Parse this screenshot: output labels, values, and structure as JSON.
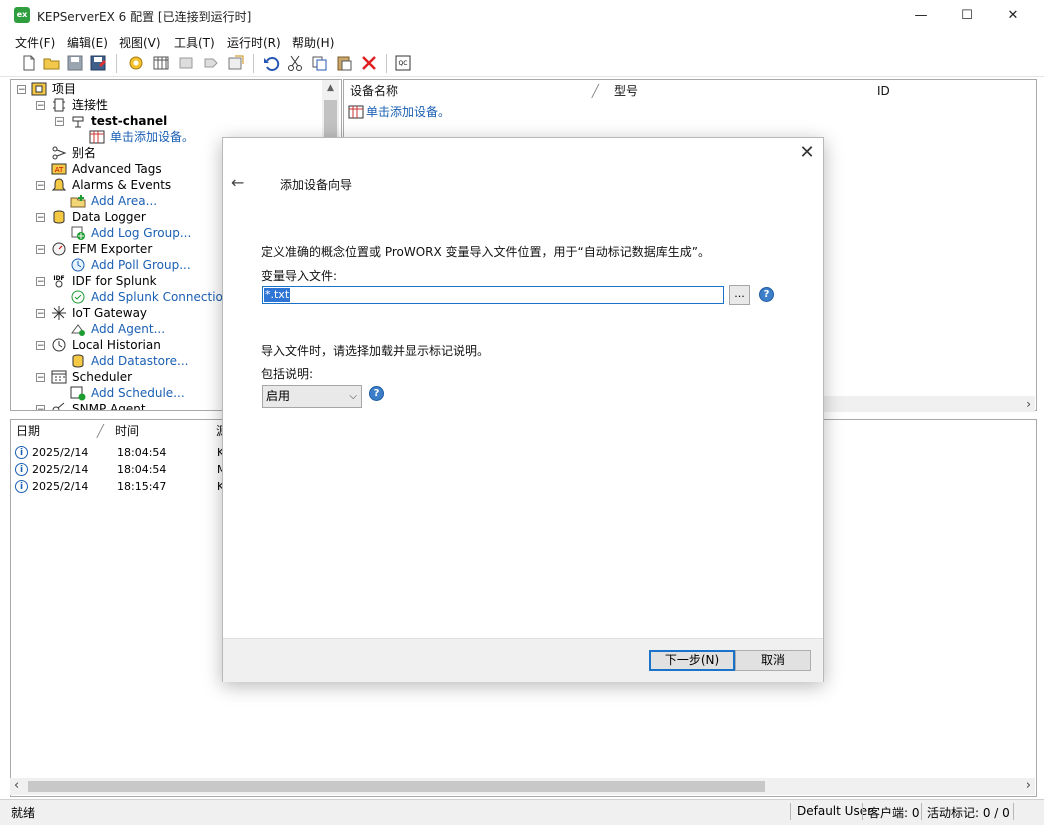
{
  "window": {
    "title": "KEPServerEX 6 配置 [已连接到运行时]",
    "app_icon_text": "ex",
    "controls": {
      "minimize": "—",
      "maximize": "☐",
      "close": "✕"
    }
  },
  "menu": [
    "文件(F)",
    "编辑(E)",
    "视图(V)",
    "工具(T)",
    "运行时(R)",
    "帮助(H)"
  ],
  "toolbar_icons": [
    "new-file-icon",
    "open-folder-icon",
    "save-icon",
    "save-as-icon",
    "new-channel-icon",
    "new-device-icon",
    "new-group-icon",
    "new-tag-icon",
    "bulk-tags-icon",
    "undo-icon",
    "cut-icon",
    "copy-icon",
    "paste-icon",
    "delete-icon",
    "quick-client-icon"
  ],
  "tree": {
    "root_label": "项目",
    "items": [
      {
        "label": "连接性",
        "style": "normal"
      },
      {
        "label": "test-chanel",
        "style": "bold"
      },
      {
        "label": "单击添加设备。",
        "style": "link"
      },
      {
        "label": "别名",
        "style": "normal"
      },
      {
        "label": "Advanced Tags",
        "style": "normal"
      },
      {
        "label": "Alarms & Events",
        "style": "normal"
      },
      {
        "label": "Add Area...",
        "style": "link"
      },
      {
        "label": "Data Logger",
        "style": "normal"
      },
      {
        "label": "Add Log Group...",
        "style": "link"
      },
      {
        "label": "EFM Exporter",
        "style": "normal"
      },
      {
        "label": "Add Poll Group...",
        "style": "link"
      },
      {
        "label": "IDF for Splunk",
        "style": "normal"
      },
      {
        "label": "Add Splunk Connection...",
        "style": "link"
      },
      {
        "label": "IoT Gateway",
        "style": "normal"
      },
      {
        "label": "Add Agent...",
        "style": "link"
      },
      {
        "label": "Local Historian",
        "style": "normal"
      },
      {
        "label": "Add Datastore...",
        "style": "link"
      },
      {
        "label": "Scheduler",
        "style": "normal"
      },
      {
        "label": "Add Schedule...",
        "style": "link"
      },
      {
        "label": "SNMP Agent",
        "style": "normal"
      }
    ]
  },
  "device_list": {
    "columns": [
      "设备名称",
      "型号",
      "ID"
    ],
    "rows": [
      {
        "name": "单击添加设备。"
      }
    ]
  },
  "log": {
    "columns": [
      "日期",
      "时间",
      "源"
    ],
    "rows": [
      {
        "date": "2025/2/14",
        "time": "18:04:54",
        "source": "K"
      },
      {
        "date": "2025/2/14",
        "time": "18:04:54",
        "source": "M"
      },
      {
        "date": "2025/2/14",
        "time": "18:15:47",
        "source": "K"
      }
    ]
  },
  "status": {
    "left": "就绪",
    "user": "Default User",
    "clients": "客户端: 0",
    "active_tags": "活动标记: 0 / 0"
  },
  "dialog": {
    "title": "添加设备向导",
    "description": "定义准确的概念位置或 ProWORX 变量导入文件位置，用于“自动标记数据库生成”。",
    "file_label": "变量导入文件:",
    "file_value": "*.txt",
    "browse_label": "...",
    "description2": "导入文件时，请选择加载并显示标记说明。",
    "include_label": "包括说明:",
    "include_value": "启用",
    "next_label": "下一步(N)",
    "cancel_label": "取消"
  }
}
